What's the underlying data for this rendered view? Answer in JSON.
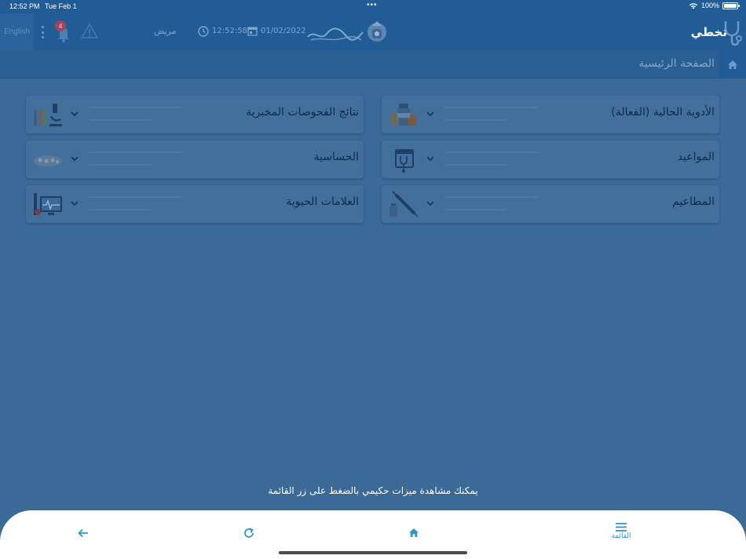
{
  "status_bar": {
    "time": "12:52 PM",
    "date": "Tue Feb 1",
    "battery": "100%",
    "dots": "•••"
  },
  "header": {
    "language_button": "English",
    "notification_count": "4",
    "user_role": "مريض",
    "clock": "12:52:58",
    "date": "01/02/2022",
    "app_name": "تخطي"
  },
  "breadcrumb": {
    "title": "الصفحة الرئيسية"
  },
  "cards": [
    {
      "label": "الأدوية الحالية (الفعالة)",
      "icon": "medicine-bottles-icon"
    },
    {
      "label": "نتائج الفحوصات المخبرية",
      "icon": "lab-microscope-icon"
    },
    {
      "label": "المواعيد",
      "icon": "calendar-stethoscope-icon"
    },
    {
      "label": "الحساسية",
      "icon": "pills-icon"
    },
    {
      "label": "المطاعيم",
      "icon": "syringe-icon"
    },
    {
      "label": "العلامات الحيوية",
      "icon": "vital-monitor-icon"
    }
  ],
  "hint": "يمكنك مشاهدة ميزات حكيمي بالضغط على زر القائمة",
  "bottom_nav": {
    "menu_label": "القائمة"
  },
  "colors": {
    "header_bg": "#215c97",
    "overlay_bg": "#3b6a98",
    "card_bg": "#426f9c",
    "accent": "#2e9ac7"
  }
}
